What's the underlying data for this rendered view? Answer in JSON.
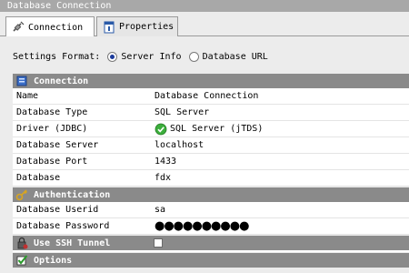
{
  "window": {
    "title": "Database Connection"
  },
  "tabs": [
    {
      "label": "Connection",
      "icon": "connection-icon"
    },
    {
      "label": "Properties",
      "icon": "properties-icon"
    }
  ],
  "settings_format": {
    "label": "Settings Format:",
    "options": [
      {
        "label": "Server Info",
        "selected": true
      },
      {
        "label": "Database URL",
        "selected": false
      }
    ]
  },
  "sections": {
    "connection": {
      "title": "Connection",
      "rows": [
        {
          "label": "Name",
          "value": "Database Connection"
        },
        {
          "label": "Database Type",
          "value": "SQL Server"
        },
        {
          "label": "Driver (JDBC)",
          "value": "SQL Server (jTDS)"
        },
        {
          "label": "Database Server",
          "value": "localhost"
        },
        {
          "label": "Database Port",
          "value": "1433"
        },
        {
          "label": "Database",
          "value": "fdx"
        }
      ]
    },
    "authentication": {
      "title": "Authentication",
      "rows": [
        {
          "label": "Database Userid",
          "value": "sa"
        },
        {
          "label": "Database Password",
          "value": "●●●●●●●●●●"
        }
      ]
    },
    "ssh": {
      "title": "Use SSH Tunnel",
      "checked": false
    },
    "options": {
      "title": "Options"
    }
  },
  "colors": {
    "section_header": "#8a8a8a",
    "title_bar": "#a8a8a8",
    "driver_ok": "#3cae3c"
  }
}
